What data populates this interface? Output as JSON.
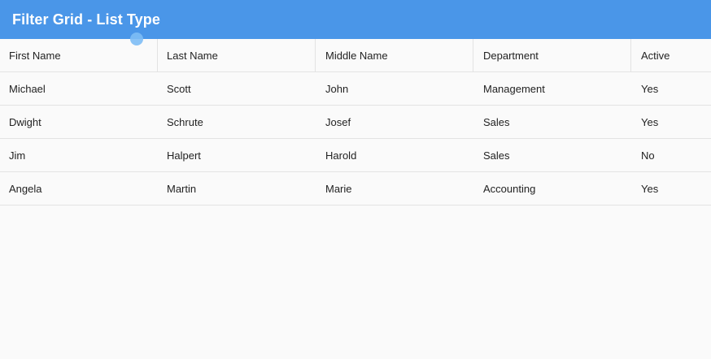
{
  "app_bar": {
    "title": "Filter Grid - List Type",
    "color": "#4a96e8"
  },
  "grid": {
    "columns": [
      "First Name",
      "Last Name",
      "Middle Name",
      "Department",
      "Active"
    ],
    "rows": [
      [
        "Michael",
        "Scott",
        "John",
        "Management",
        "Yes"
      ],
      [
        "Dwight",
        "Schrute",
        "Josef",
        "Sales",
        "Yes"
      ],
      [
        "Jim",
        "Halpert",
        "Harold",
        "Sales",
        "No"
      ],
      [
        "Angela",
        "Martin",
        "Marie",
        "Accounting",
        "Yes"
      ]
    ]
  }
}
